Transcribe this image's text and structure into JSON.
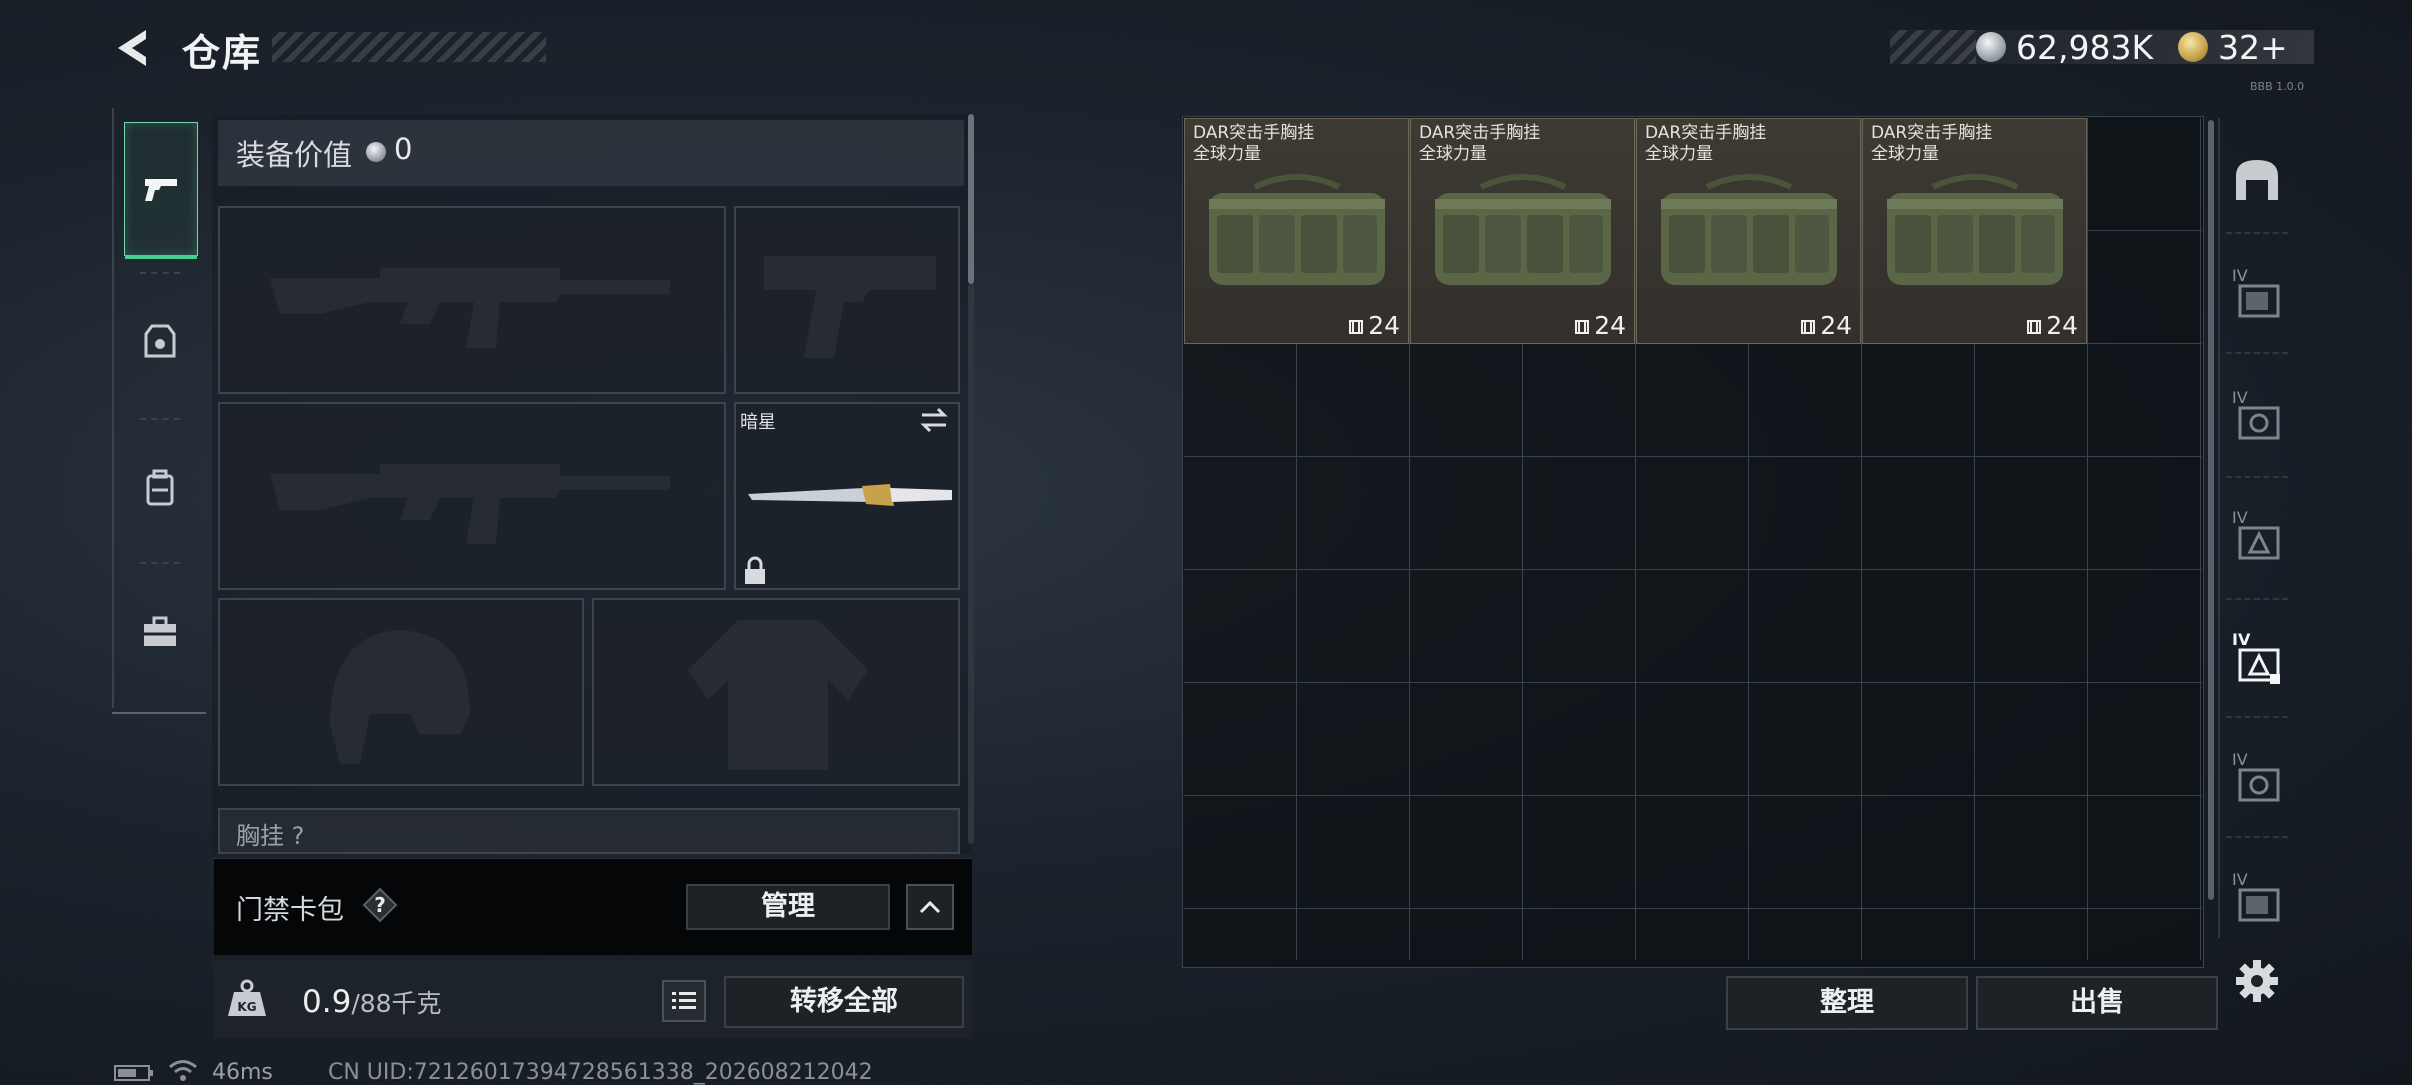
{
  "header": {
    "title": "仓库",
    "money": "62,983K",
    "tokens": "32+",
    "tiny_text": "BBB 1.0.0"
  },
  "equipment": {
    "value_label": "装备价值",
    "value": "0",
    "knife_name": "暗星",
    "chest_rig_label": "胸挂 ?"
  },
  "keycard": {
    "label": "门禁卡包",
    "manage_label": "管理"
  },
  "weight": {
    "current": "0.9",
    "max": "/88千克",
    "transfer_label": "转移全部"
  },
  "stash": {
    "items": [
      {
        "name_line1": "DAR突击手胸挂",
        "name_line2": "全球力量",
        "capacity": "24"
      },
      {
        "name_line1": "DAR突击手胸挂",
        "name_line2": "全球力量",
        "capacity": "24"
      },
      {
        "name_line1": "DAR突击手胸挂",
        "name_line2": "全球力量",
        "capacity": "24"
      },
      {
        "name_line1": "DAR突击手胸挂",
        "name_line2": "全球力量",
        "capacity": "24"
      }
    ],
    "sort_label": "整理",
    "sell_label": "出售"
  },
  "status": {
    "ping": "46ms",
    "uid": "CN UID:72126017394728561338_202608212042"
  },
  "right_tabs": [
    {
      "label": "IV"
    },
    {
      "label": "IV"
    },
    {
      "label": "IV"
    },
    {
      "label": "IV"
    },
    {
      "label": "IV"
    },
    {
      "label": "IV"
    }
  ],
  "colors": {
    "accent_green": "#45d08e",
    "item_bg": "#3d3a34",
    "background": "#1c232c"
  }
}
